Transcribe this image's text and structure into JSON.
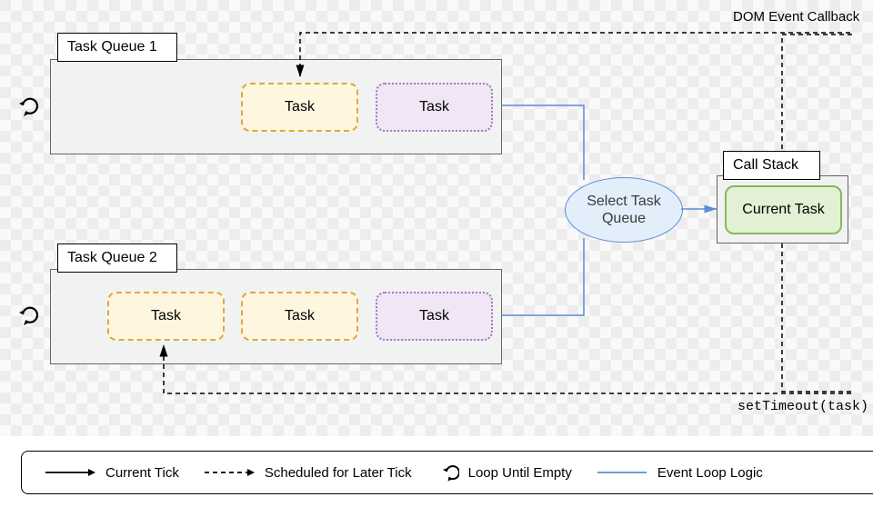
{
  "diagram": {
    "queue1_label": "Task Queue 1",
    "queue2_label": "Task Queue 2",
    "callstack_label": "Call Stack",
    "selector_label": "Select Task Queue",
    "current_task": "Current Task",
    "task": "Task",
    "dom_callback": "DOM Event Callback",
    "set_timeout": "setTimeout(task)"
  },
  "legend": {
    "current_tick": "Current Tick",
    "later_tick": "Scheduled for Later Tick",
    "loop_empty": "Loop Until Empty",
    "event_loop": "Event Loop Logic"
  }
}
